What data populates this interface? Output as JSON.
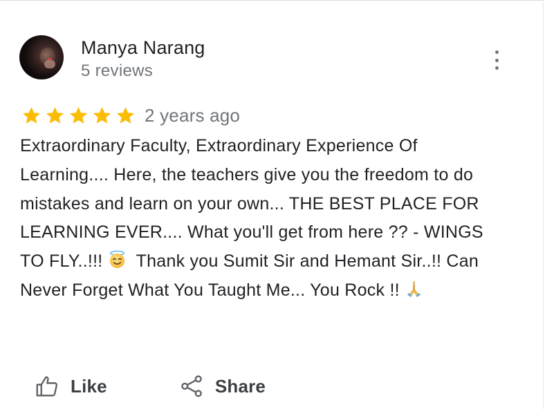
{
  "reviewer": {
    "name": "Manya Narang",
    "reviews_count": "5 reviews"
  },
  "review": {
    "rating": 5,
    "max_rating": 5,
    "star_color": "#fbbc04",
    "time": "2 years ago",
    "text_part1": "Extraordinary Faculty, Extraordinary Experience Of Learning.... Here, the teachers give you the freedom to do mistakes and learn on your own... THE BEST PLACE FOR LEARNING EVER.... What you'll get from here ?? - WINGS TO FLY..!!! ",
    "emoji1": "smiling-face-with-halo-icon",
    "text_part2": "  Thank you Sumit Sir and Hemant Sir..!! Can Never Forget What You Taught Me... You Rock !! ",
    "emoji2": "folded-hands-icon"
  },
  "menu": {
    "icon": "more-vert-icon"
  },
  "actions": {
    "like_label": "Like",
    "like_icon": "thumb-up-icon",
    "share_label": "Share",
    "share_icon": "share-icon"
  }
}
